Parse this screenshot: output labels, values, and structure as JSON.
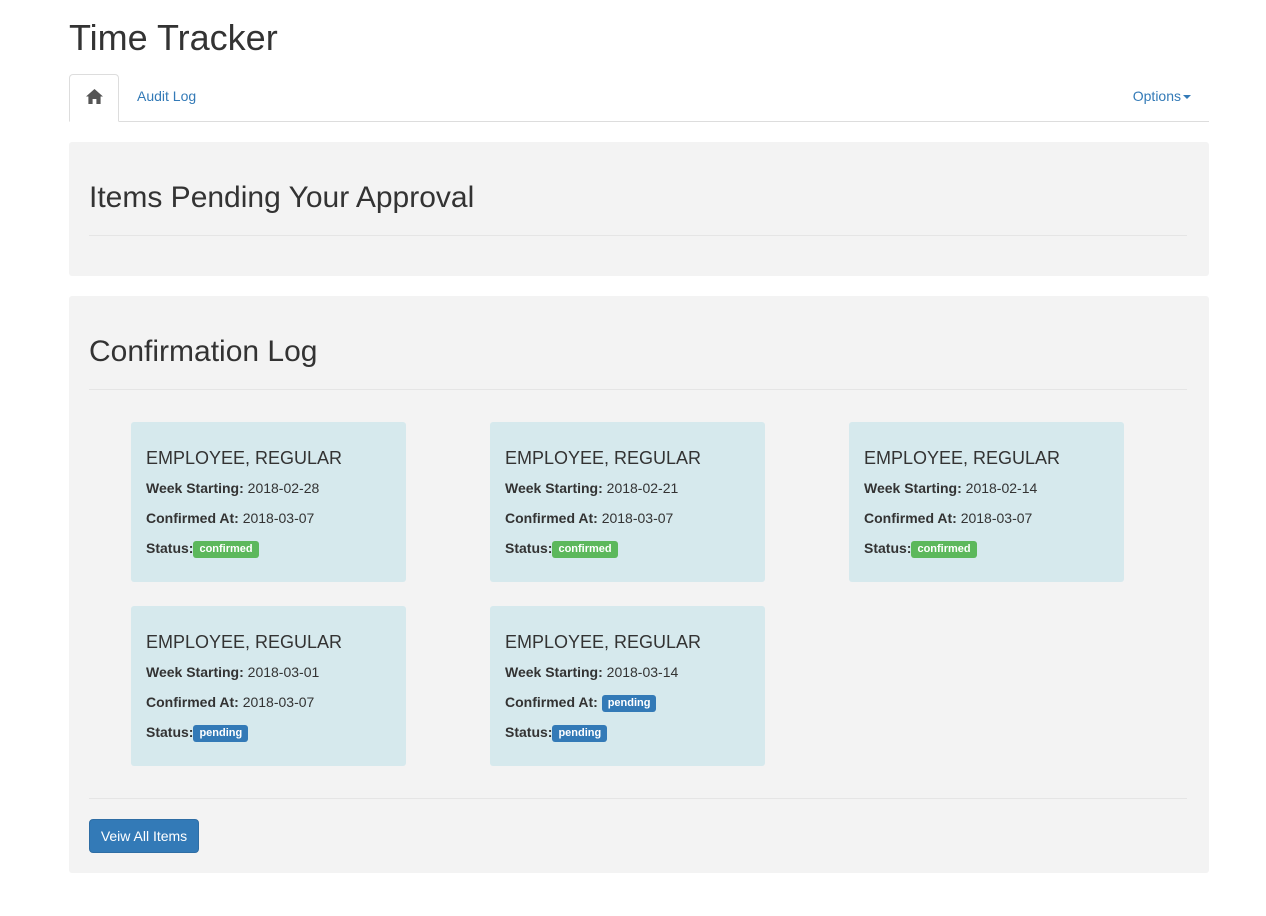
{
  "app": {
    "title": "Time Tracker"
  },
  "tabs": {
    "home_icon": "home-icon",
    "audit_log": "Audit Log",
    "options": "Options"
  },
  "pending_panel": {
    "title": "Items Pending Your Approval"
  },
  "log_panel": {
    "title": "Confirmation Log",
    "labels": {
      "week": "Week Starting:",
      "confirmed": "Confirmed At:",
      "status": "Status:"
    },
    "cards": [
      {
        "name": "EMPLOYEE, REGULAR",
        "week": "2018-02-28",
        "confirmed_at": "2018-03-07",
        "confirmed_badge": "",
        "status": "confirmed"
      },
      {
        "name": "EMPLOYEE, REGULAR",
        "week": "2018-02-21",
        "confirmed_at": "2018-03-07",
        "confirmed_badge": "",
        "status": "confirmed"
      },
      {
        "name": "EMPLOYEE, REGULAR",
        "week": "2018-02-14",
        "confirmed_at": "2018-03-07",
        "confirmed_badge": "",
        "status": "confirmed"
      },
      {
        "name": "EMPLOYEE, REGULAR",
        "week": "2018-03-01",
        "confirmed_at": "2018-03-07",
        "confirmed_badge": "",
        "status": "pending"
      },
      {
        "name": "EMPLOYEE, REGULAR",
        "week": "2018-03-14",
        "confirmed_at": "",
        "confirmed_badge": "pending",
        "status": "pending"
      }
    ],
    "view_all_label": "Veiw All Items"
  },
  "colors": {
    "link": "#337ab7",
    "confirmed": "#5cb85c",
    "pending": "#337ab7",
    "card": "#d6e9ed",
    "panel": "#f3f3f3"
  }
}
